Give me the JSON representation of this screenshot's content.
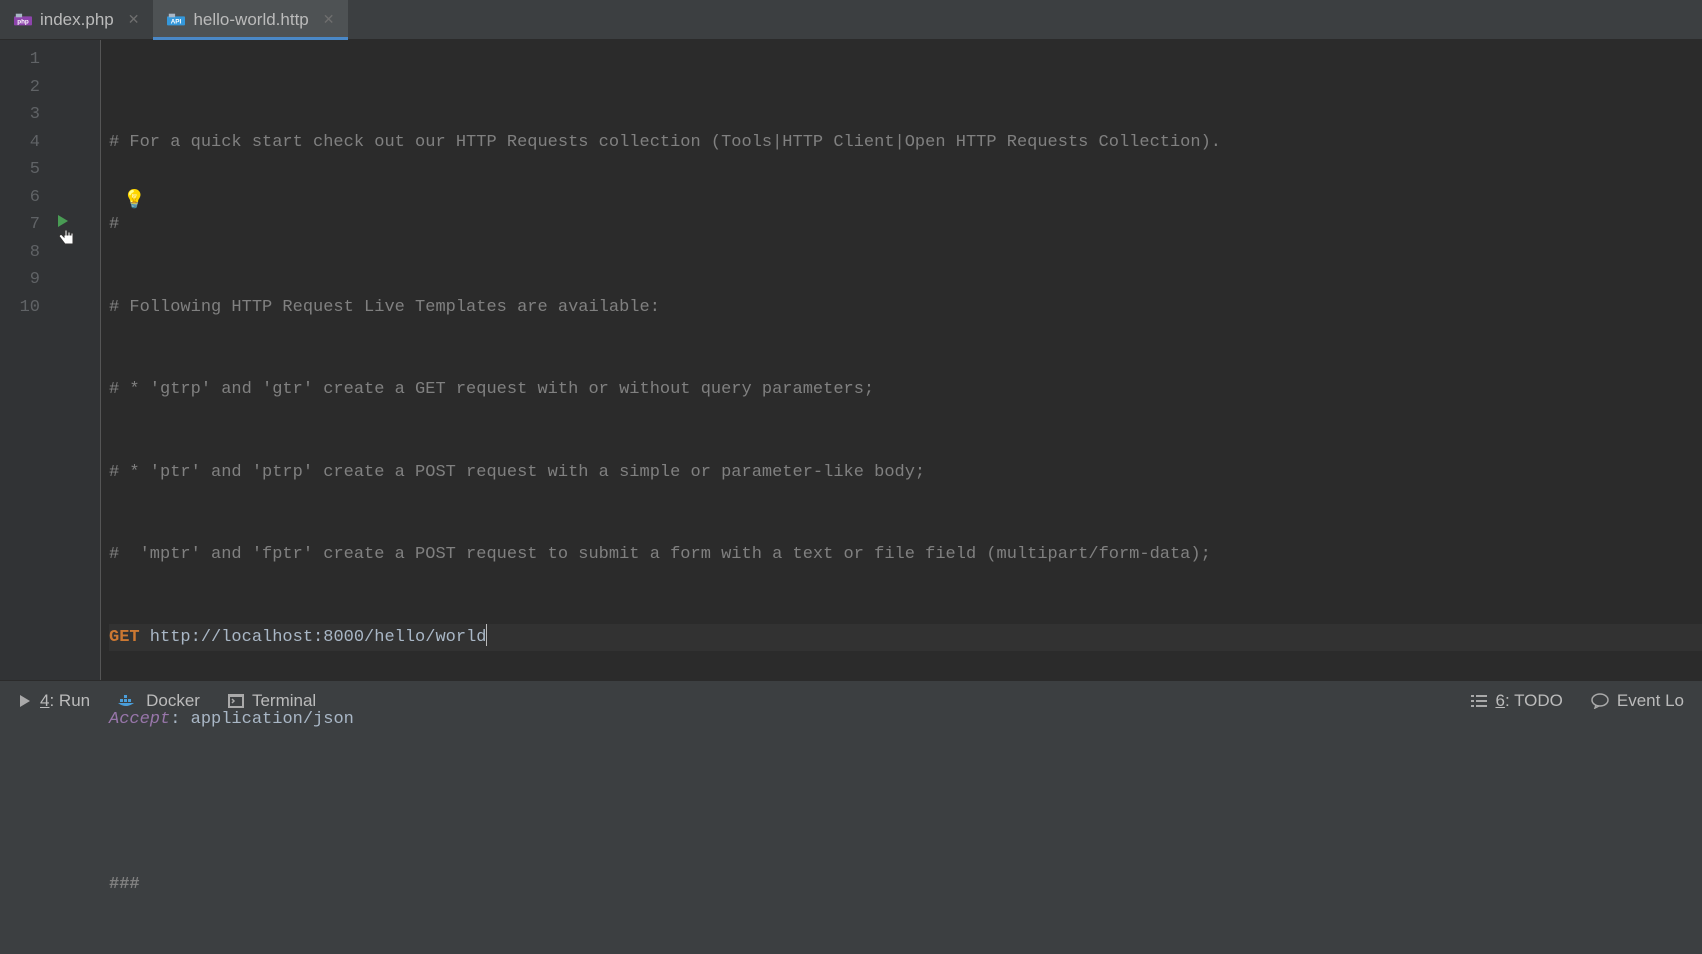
{
  "tabs": [
    {
      "label": "index.php",
      "icon": "php"
    },
    {
      "label": "hello-world.http",
      "icon": "api"
    }
  ],
  "gutter": [
    "1",
    "2",
    "3",
    "4",
    "5",
    "6",
    "7",
    "8",
    "9",
    "10"
  ],
  "code": {
    "l1": "# For a quick start check out our HTTP Requests collection (Tools|HTTP Client|Open HTTP Requests Collection).",
    "l2": "#",
    "l3": "# Following HTTP Request Live Templates are available:",
    "l4": "# * 'gtrp' and 'gtr' create a GET request with or without query parameters;",
    "l5": "# * 'ptr' and 'ptrp' create a POST request with a simple or parameter-like body;",
    "l6a": "# ",
    "l6b": " 'mptr' and 'fptr' create a POST request to submit a form with a text or file field (multipart/form-data);",
    "l7_method": "GET",
    "l7_url": " http://localhost:8000/hello/world",
    "l8_key": "Accept",
    "l8_sep": ": ",
    "l8_val": "application/json",
    "l10": "###"
  },
  "status": {
    "run_num": "4",
    "run": ": Run",
    "docker": "Docker",
    "terminal": "Terminal",
    "todo_num": "6",
    "todo": ": TODO",
    "eventlog": "Event Lo"
  }
}
